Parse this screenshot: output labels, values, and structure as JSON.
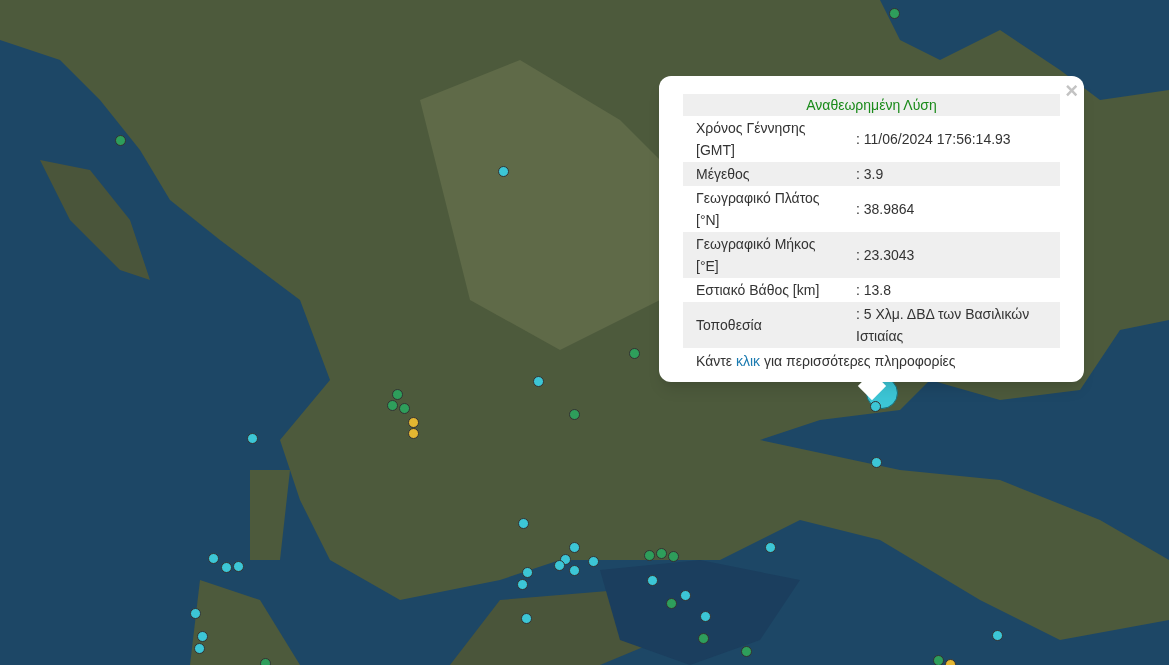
{
  "markers": [
    {
      "color": "#2e9e5b",
      "selected": false
    },
    {
      "color": "#2e9e5b",
      "selected": false
    },
    {
      "color": "#3cc6d6",
      "selected": false
    },
    {
      "color": "#2e9e5b",
      "selected": false
    },
    {
      "color": "#3cc6d6",
      "selected": false
    },
    {
      "color": "#2e9e5b",
      "selected": false
    },
    {
      "color": "#2e9e5b",
      "selected": false
    },
    {
      "color": "#2e9e5b",
      "selected": false
    },
    {
      "color": "#2e9e5b",
      "selected": false
    },
    {
      "color": "#e3b631",
      "selected": false
    },
    {
      "color": "#e3b631",
      "selected": false
    },
    {
      "color": "#3cc6d6",
      "selected": false
    },
    {
      "color": "#3cc6d6",
      "selected": true
    },
    {
      "color": "#3cc6d6",
      "selected": false
    },
    {
      "color": "#3cc6d6",
      "selected": false
    },
    {
      "color": "#3cc6d6",
      "selected": false
    },
    {
      "color": "#3cc6d6",
      "selected": false
    },
    {
      "color": "#2e9e5b",
      "selected": false
    },
    {
      "color": "#2e9e5b",
      "selected": false
    },
    {
      "color": "#2e9e5b",
      "selected": false
    },
    {
      "color": "#3cc6d6",
      "selected": false
    },
    {
      "color": "#3cc6d6",
      "selected": false
    },
    {
      "color": "#3cc6d6",
      "selected": false
    },
    {
      "color": "#3cc6d6",
      "selected": false
    },
    {
      "color": "#3cc6d6",
      "selected": false
    },
    {
      "color": "#3cc6d6",
      "selected": false
    },
    {
      "color": "#3cc6d6",
      "selected": false
    },
    {
      "color": "#3cc6d6",
      "selected": false
    },
    {
      "color": "#3cc6d6",
      "selected": false
    },
    {
      "color": "#3cc6d6",
      "selected": false
    },
    {
      "color": "#3cc6d6",
      "selected": false
    },
    {
      "color": "#2e9e5b",
      "selected": false
    },
    {
      "color": "#3cc6d6",
      "selected": false
    },
    {
      "color": "#3cc6d6",
      "selected": false
    },
    {
      "color": "#3cc6d6",
      "selected": false
    },
    {
      "color": "#3cc6d6",
      "selected": false
    },
    {
      "color": "#3cc6d6",
      "selected": false
    },
    {
      "color": "#2e9e5b",
      "selected": false
    },
    {
      "color": "#2e9e5b",
      "selected": false
    },
    {
      "color": "#3cc6d6",
      "selected": false
    },
    {
      "color": "#2e9e5b",
      "selected": false
    },
    {
      "color": "#e3b631",
      "selected": false
    },
    {
      "color": "#2e9e5b",
      "selected": false
    },
    {
      "color": "#3cc6d6",
      "selected": false
    }
  ],
  "popup": {
    "close": "×",
    "title": "Αναθεωρημένη Λύση",
    "rows": [
      {
        "label": "Χρόνος Γέννησης [GMT]",
        "value": ": 11/06/2024 17:56:14.93"
      },
      {
        "label": "Μέγεθος",
        "value": ": 3.9"
      },
      {
        "label": "Γεωγραφικό Πλάτος [°N]",
        "value": ": 38.9864"
      },
      {
        "label": "Γεωγραφικό Μήκος [°E]",
        "value": ": 23.3043"
      },
      {
        "label": "Εστιακό Βάθος [km]",
        "value": ": 13.8"
      },
      {
        "label": "Τοποθεσία",
        "value": ": 5 Χλμ. ΔΒΔ των Βασιλικών Ιστιαίας"
      }
    ],
    "footer": {
      "before": "Κάντε ",
      "link": "κλικ",
      "after": " για περισσότερες πληροφορίες"
    }
  }
}
